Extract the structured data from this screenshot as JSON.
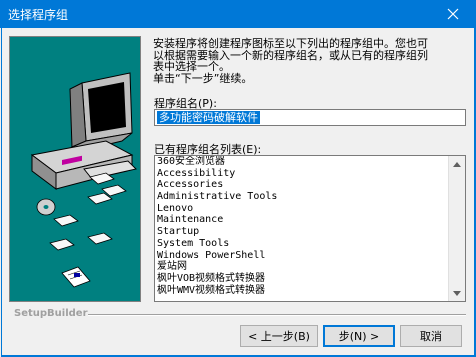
{
  "window": {
    "title": "选择程序组"
  },
  "description": {
    "lines": [
      "安装程序将创建程序图标至以下列出的程序组中。您也可",
      "以根据需要输入一个新的程序组名，或从已有的程序组列",
      "表中选择一个。",
      "单击“下一步”继续。"
    ]
  },
  "group_name": {
    "label": "程序组名(P):",
    "value": "多功能密码破解软件"
  },
  "existing_groups": {
    "label": "已有程序组名列表(E):",
    "items": [
      "360安全浏览器",
      "Accessibility",
      "Accessories",
      "Administrative Tools",
      "Lenovo",
      "Maintenance",
      "Startup",
      "System Tools",
      "Windows PowerShell",
      "爱站网",
      "枫叶VOB视频格式转换器",
      "枫叶WMV视频格式转换器"
    ]
  },
  "footer": {
    "brand": "SetupBuilder",
    "back_label": "< 上一步(B)",
    "next_label": "步(N) >",
    "cancel_label": "取消"
  },
  "colors": {
    "accent": "#0078d7",
    "art_background": "#008080"
  }
}
